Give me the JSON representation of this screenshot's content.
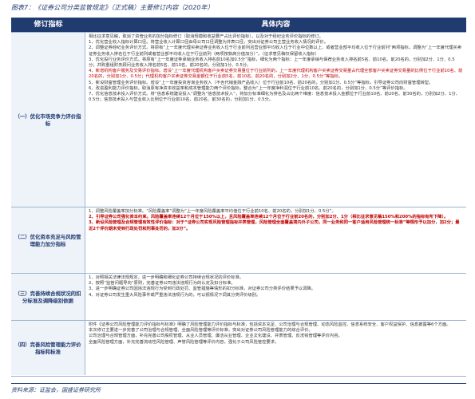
{
  "caption": "图表7：《证券公司分类监管规定》（正式稿）主要修订内容（2020年）",
  "table": {
    "headers": [
      "修订指标",
      "具体内容"
    ],
    "rows": [
      {
        "category": "（一）优化市场竞争力评价指标",
        "lines": [
          {
            "text": "相比征求意见稿，取消了资管业务的加分指标修订（取消规模和收益要产占比评价指标），以及对于经纪业务评价指标的修订。",
            "style": "normal"
          },
          {
            "text": "1、优化营业收入指标计算口径。将营业收入计算口径由母公司口径调整为并表口径，突出对证券公司主营业务收入情况的评价。",
            "style": "normal"
          },
          {
            "text": "2、调整证券经纪业务评价方式。将原有“上一年度代理买卖证券业务收入位于行业前列且营业部平均收入位于行业中位数以上、或者营业部平均收入位于行业前列”两项指标，调整为“上一年度代理买卖证券业务收入排名位于行业前列或者营业部平均收入位于行业前列（两项按孰高分值加分）”。（征求意见稿仅保留收入指标）",
            "style": "mixed"
          },
          {
            "text": "3、优化投行业务评价方式。将原有“上一年度证券承销业务收入排名前10名加0.5分”指标，细化为两个指标：上一年度承销与保荐业务收入排名前5名、前10名、前20名的，分别加2分、1分、0.5分；并购重组财务顾问业务收入排名前5名、前10名、前20名的，分别加1分、0.5分。",
            "style": "normal"
          },
          {
            "text": "4、新增机构客户服务及交易评价指标。增设“上一年度代理机构客户买卖证券交易量位于行业前列的，上一年度代理机构客户买卖证券交易量占代理全部客户买卖证券交易量的比例位于行业前10名、前20名的，分别加1分、0.5分；代理机构客户买卖证券交易金额位于行业前5名、前10名、前20名的，分别加2分、1分、0.5分”等指标。",
            "style": "red"
          },
          {
            "text": "5、新设财富管理业务评价指标。增设“上一年度投资咨询业务收入（不含代销金融产品收入）位于行业前10名、前20名的，分别加1分、0.5分”等指标，引导证券公司向财富管理转型。",
            "style": "mixed"
          },
          {
            "text": "6、改进盈利能力评价指标。取消原有净资本收益率和成本管理能力两个评价指标，整合为“上一年度净利润位于行业前10名、前20名的，分别加1分、0.5分”等评价指标。",
            "style": "normal"
          },
          {
            "text": "7、优化信息技术投入评价方式。将“信息系统建设投入”调整为“信息技术投入”，将加分标准细化为排名及占比两个维度：信息技术投入金额位于行业前10名、前20名、前30名的，分别加2分、1分、0.5分；信息技术投入与营业收入比例位于行业前10名、前20名、前30名的，分别加1分、0.5分。",
            "style": "normal"
          }
        ]
      },
      {
        "category": "（二）优化资本充足与风险管理能力加分指标",
        "lines": [
          {
            "text": "1、调整风险覆盖率加分标准。“风险覆盖率”调整为“上一年度风险覆盖率平均值位于行业前10名、前20名的，分别加1分、0.5分”。",
            "style": "normal"
          },
          {
            "text": "2、引导证券公司强化资本约束。风险覆盖率连续12个月位于150%以上，且风险覆盖率连续12个月位于行业前20名的，分别加2分、1分（相比征求意见稿150%和200%的指标有所下降）。",
            "style": "mixed"
          },
          {
            "text": "3、新设风险管理及合规管理有效性评价指标：对于“证券公司实现风险管理指标并表管理，风险管理全面覆盖境内外子公司，同一业务和同一客户适用风险管理统一标准”等情形予以加分，加2分；最近2个评价期未受到行政处罚和刑事处罚的，加3分”。",
            "style": "red"
          }
        ]
      },
      {
        "category": "（三）完善持续合规状况的扣分标准及调降级别依据",
        "lines": [
          {
            "text": "1、对照相关法律法规规定，进一步明确和细化证券公司持续合规状况的评价标准。",
            "style": "normal"
          },
          {
            "text": "2、按照“监管问题导向”原则，完善证券公司违法违规行为的认定及扣分标准。",
            "style": "normal"
          },
          {
            "text": "3、进一步明确证券公司因违法违规行为受到行政处罚、监管措施等情形的扣分标准，对证券公司分类评价结果予以调降。",
            "style": "normal"
          },
          {
            "text": "4、对证券公司发生重大风险事件或严重违法违规行为的，可以视情况下调其分类评价级别。",
            "style": "normal"
          }
        ]
      },
      {
        "category": "（四）完善风险管理能力评价指标和标准",
        "lines": [
          {
            "text": "附件《证券公司风险管理能力评价指标与标准》明确了风险管理能力评价指标与标准，包括资本充足、公司治理与合规管理、动态风险监控、信息系统安全、客户权益保护、信息披露等6个方面。",
            "style": "normal"
          },
          {
            "text": "本次修订主要进一步完善了公司治理与合规管理、全面风险管理等评价标准，突出对证券公司风险管理能力的综合评价。",
            "style": "normal"
          },
          {
            "text": "公司治理与合规管理方面，补充完善公司股权管理、从业人员管理、廉洁从业管理、企业文化建设、并表管理、反洗钱管理等评价内容。",
            "style": "normal"
          },
          {
            "text": "全面风险管理方面，补充完善流动性风险管理、声誉风险管理等评价内容，强化子公司风险管控要求。",
            "style": "normal"
          }
        ]
      }
    ]
  },
  "source": "资料来源：证监会，国盛证券研究所"
}
